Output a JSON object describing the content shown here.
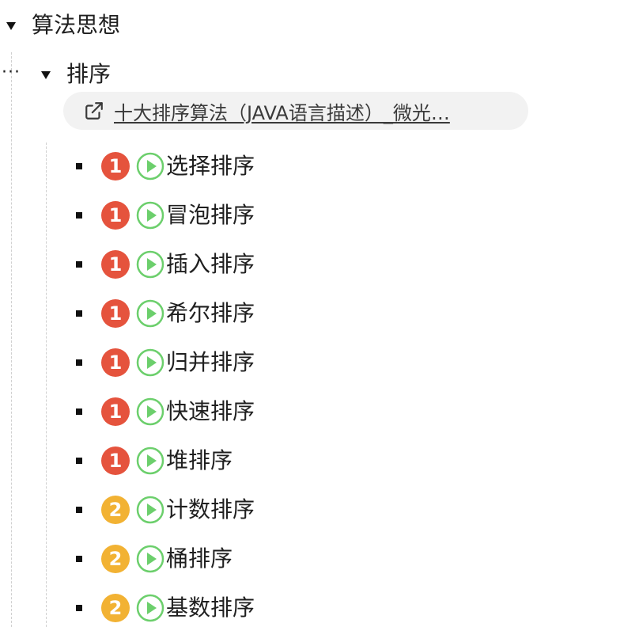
{
  "root": {
    "title": "算法思想"
  },
  "child": {
    "title": "排序",
    "more_label": "···",
    "link": {
      "text": "十大排序算法（JAVA语言描述）_微光…",
      "icon": "external-link-icon"
    },
    "items": [
      {
        "label": "选择排序",
        "priority": "1",
        "priority_color": "#e5533d",
        "play_color": "#6ccf6c"
      },
      {
        "label": "冒泡排序",
        "priority": "1",
        "priority_color": "#e5533d",
        "play_color": "#6ccf6c"
      },
      {
        "label": "插入排序",
        "priority": "1",
        "priority_color": "#e5533d",
        "play_color": "#6ccf6c"
      },
      {
        "label": "希尔排序",
        "priority": "1",
        "priority_color": "#e5533d",
        "play_color": "#6ccf6c"
      },
      {
        "label": "归并排序",
        "priority": "1",
        "priority_color": "#e5533d",
        "play_color": "#6ccf6c"
      },
      {
        "label": "快速排序",
        "priority": "1",
        "priority_color": "#e5533d",
        "play_color": "#6ccf6c"
      },
      {
        "label": "堆排序",
        "priority": "1",
        "priority_color": "#e5533d",
        "play_color": "#6ccf6c"
      },
      {
        "label": "计数排序",
        "priority": "2",
        "priority_color": "#f2b233",
        "play_color": "#6ccf6c"
      },
      {
        "label": "桶排序",
        "priority": "2",
        "priority_color": "#f2b233",
        "play_color": "#6ccf6c"
      },
      {
        "label": "基数排序",
        "priority": "2",
        "priority_color": "#f2b233",
        "play_color": "#6ccf6c"
      }
    ]
  }
}
